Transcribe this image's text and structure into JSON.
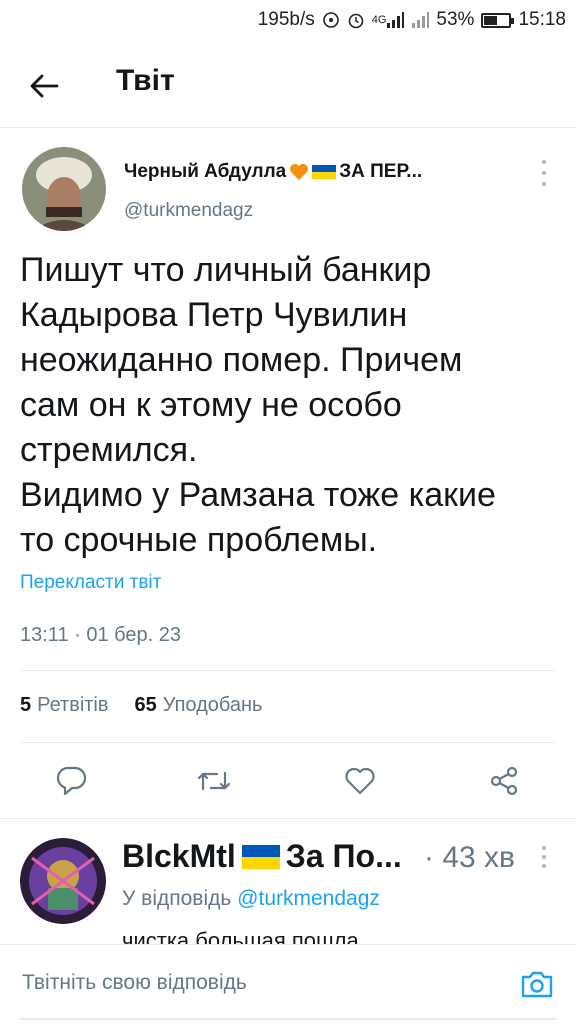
{
  "status_bar": {
    "speed": "195b/s",
    "network": "4G",
    "battery_percent": "53%",
    "battery_level": 0.53,
    "time": "15:18"
  },
  "header": {
    "title": "Твіт"
  },
  "tweet": {
    "author_name": "Черный Абдулла",
    "author_name_suffix": "ЗА ПЕР...",
    "author_handle": "@turkmendagz",
    "text_lines": [
      "Пишут что личный банкир",
      "Кадырова Петр Чувилин",
      "неожиданно помер. Причем",
      "сам он к этому не особо",
      "стремился.",
      "Видимо у Рамзана тоже какие",
      "то срочные проблемы."
    ],
    "translate_label": "Перекласти твіт",
    "timestamp": "13:11 · 01 бер. 23",
    "retweets_count": "5",
    "retweets_label": "Ретвітів",
    "likes_count": "65",
    "likes_label": "Уподобань"
  },
  "reply": {
    "author_name": "BlckMtl",
    "author_name_suffix": "За По...",
    "time": "· 43 хв",
    "reply_to_label": "У відповідь",
    "reply_to_handle": "@turkmendagz",
    "text": "чистка большая пошла"
  },
  "compose": {
    "placeholder": "Твітніть свою відповідь"
  },
  "colors": {
    "accent": "#1da1f2",
    "secondary_text": "#657786",
    "heart": "#f4900c",
    "flag_blue": "#0057b7",
    "flag_yellow": "#ffd700"
  }
}
